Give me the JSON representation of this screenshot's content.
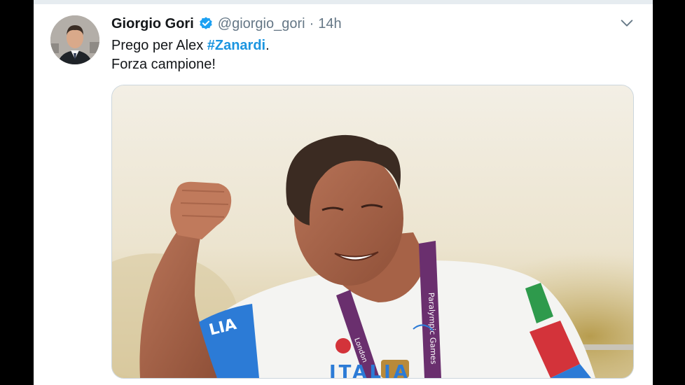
{
  "tweet": {
    "display_name": "Giorgio Gori",
    "handle": "@giorgio_gori",
    "separator": "·",
    "time": "14h",
    "text_line1_prefix": "Prego per Alex ",
    "hashtag": "#Zanardi",
    "text_line1_suffix": ".",
    "text_line2": "Forza campione!"
  },
  "photo": {
    "sleeve_text": "LIA",
    "jersey_text": "ITALIA",
    "lanyard_text": "Paralympic Games",
    "lanyard_logo": "London"
  },
  "icons": {
    "verified": "verified-badge-icon",
    "menu": "chevron-down-icon"
  },
  "colors": {
    "accent": "#1b95e0",
    "text": "#14171a",
    "secondary": "#657786",
    "verified": "#1da1f2"
  }
}
